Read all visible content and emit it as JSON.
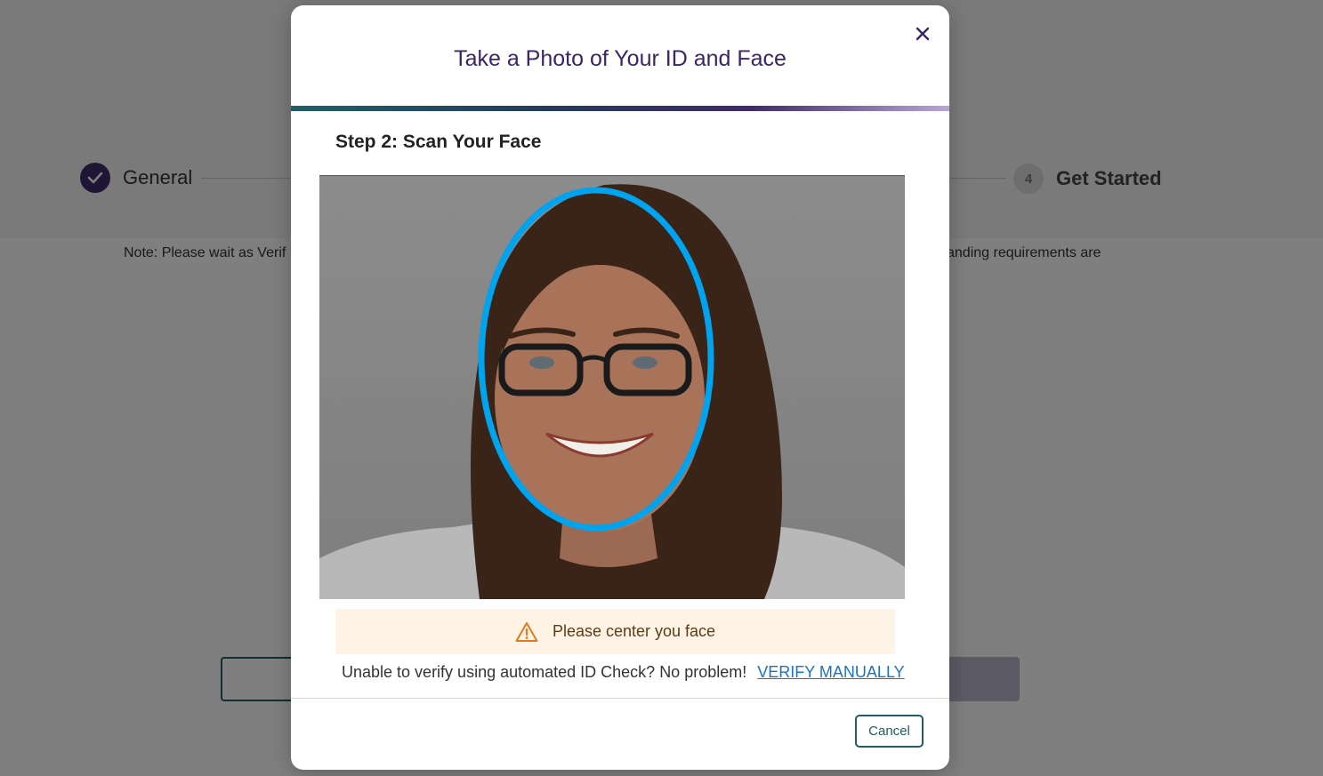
{
  "background": {
    "stepper": {
      "step1_label": "General",
      "step4_number": "4",
      "step4_label": "Get Started"
    },
    "note_left": "Note: Please wait as Verif",
    "note_right": "anding requirements are"
  },
  "modal": {
    "title": "Take a Photo of Your ID and Face",
    "step_heading": "Step 2: Scan Your Face",
    "alert_text": "Please center you face",
    "manual_prompt": "Unable to verify using automated ID Check? No problem!",
    "manual_link": "VERIFY MANUALLY",
    "cancel_label": "Cancel"
  },
  "colors": {
    "brand_purple": "#3f2a6b",
    "face_guide": "#00a3ee",
    "alert_bg": "#fef3e4",
    "alert_icon": "#e07b1f",
    "link": "#1a73c8",
    "teal_button": "#1f5e63"
  },
  "icons": {
    "close": "close-icon",
    "warning": "warning-triangle-icon",
    "check": "check-icon"
  }
}
